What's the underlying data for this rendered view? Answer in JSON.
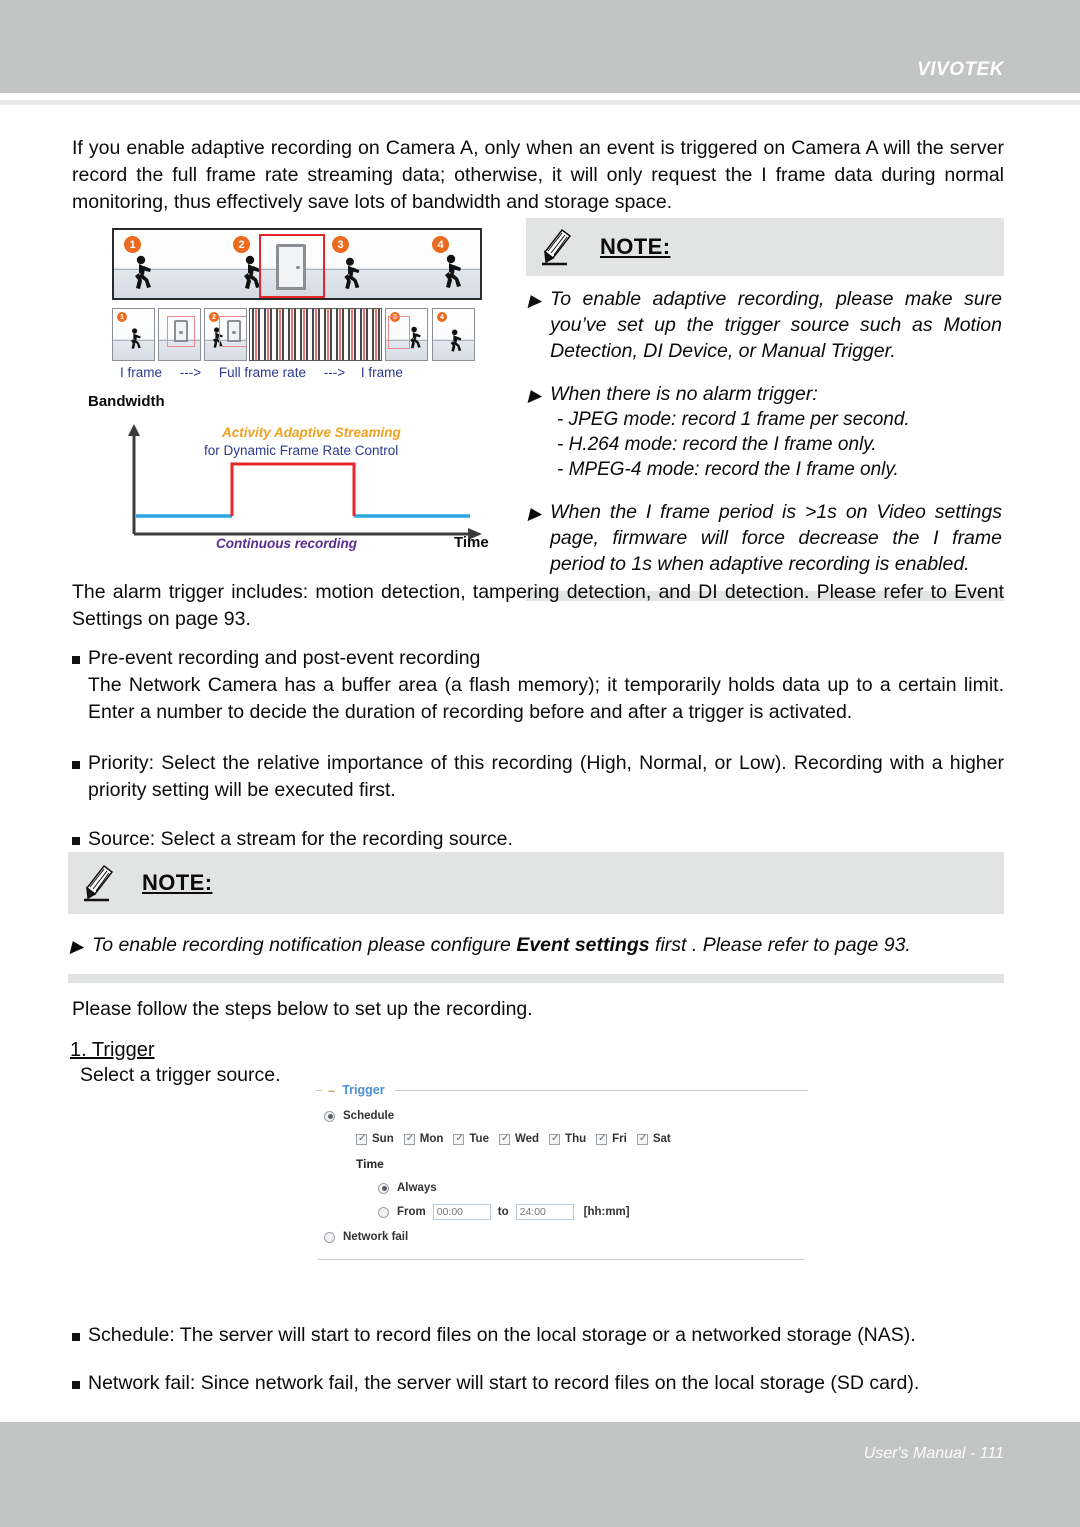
{
  "header": {
    "brand": "VIVOTEK"
  },
  "footer": {
    "text": "User's Manual - 111"
  },
  "intro": {
    "paragraph": "If you enable adaptive recording on Camera A, only when an event is triggered on Camera A will the server record the full frame rate streaming data; otherwise, it will only request the I frame data during normal monitoring, thus effectively save lots of bandwidth and storage space."
  },
  "note1": {
    "icon": "pencil-icon",
    "title": "NOTE:",
    "bullet_glyph": "▶",
    "items": [
      "To enable adaptive recording, please make sure you’ve set up the trigger source such as Motion Detection, DI Device, or Manual Trigger.",
      "When there is no alarm trigger:",
      "When the I frame period is >1s on Video settings page, firmware will force decrease the I frame period to 1s when adaptive recording is enabled."
    ],
    "sub_items": [
      "- JPEG mode: record 1 frame per second.",
      "- H.264 mode: record the I frame only.",
      "- MPEG-4 mode: record the I frame only."
    ]
  },
  "diagram": {
    "scene_badges": [
      "1",
      "2",
      "3",
      "4"
    ],
    "thumb_badges": [
      "1",
      "2",
      "3",
      "4"
    ],
    "frame_labels": {
      "i_frame_left": "I frame",
      "arrow1": "--->",
      "full_frame_rate": "Full frame rate",
      "arrow2": "--->",
      "i_frame_right": "I frame"
    },
    "chart_axis": {
      "y": "Bandwidth",
      "x": "Time"
    },
    "annotations": {
      "adaptive_title": "Activity Adaptive Streaming",
      "adaptive_sub": "for Dynamic Frame Rate Control",
      "continuous": "Continuous recording"
    },
    "colors": {
      "badge": "#ea6b1f",
      "red_line": "#e8262a",
      "blue_line": "#29a7e1",
      "accent_orange": "#f0a020",
      "label_blue": "#2b3a8f",
      "label_purple": "#5a2d8c"
    }
  },
  "chart_data": {
    "type": "line",
    "title": "Activity Adaptive Streaming for Dynamic Frame Rate Control",
    "xlabel": "Time",
    "ylabel": "Bandwidth",
    "grid": false,
    "legend": "none",
    "series": [
      {
        "name": "Continuous recording",
        "color": "#29a7e1",
        "x": [
          0,
          42,
          42,
          84,
          84,
          100
        ],
        "values": [
          12,
          12,
          12,
          12,
          12,
          12
        ]
      },
      {
        "name": "Activity Adaptive Streaming",
        "color": "#e8262a",
        "x": [
          42,
          42,
          84,
          84
        ],
        "values": [
          12,
          78,
          78,
          12
        ]
      }
    ]
  },
  "body": {
    "alarm_paragraph": "The alarm trigger includes: motion detection, tampering detection, and DI detection. Please refer to Event Settings on page 93.",
    "bullets": [
      {
        "head": "Pre-event recording and post-event recording",
        "sub": "The Network Camera has a buffer area (a flash memory); it temporarily holds data up to a certain limit. Enter a number to decide the duration of recording before and after a trigger is activated."
      },
      {
        "head": "Priority: Select the relative importance of this recording (High, Normal, or Low). Recording with a higher priority setting will be executed first.",
        "sub": ""
      },
      {
        "head": "Source: Select a stream for the recording source.",
        "sub": ""
      }
    ]
  },
  "note2": {
    "icon": "pencil-icon",
    "title": "NOTE:",
    "bullet_glyph": "▶",
    "text_before": "To enable recording notification please configure ",
    "text_bold": "Event settings",
    "text_after": " first . Please refer to page 93."
  },
  "steps_intro": "Please follow the steps below to set up the recording.",
  "step1": {
    "heading": "1. Trigger",
    "description": "Select a trigger source."
  },
  "trigger_panel": {
    "collapse_icon": "minus-icon",
    "legend": "Trigger",
    "schedule": {
      "label": "Schedule",
      "selected": true,
      "days": [
        {
          "label": "Sun",
          "checked": true
        },
        {
          "label": "Mon",
          "checked": true
        },
        {
          "label": "Tue",
          "checked": true
        },
        {
          "label": "Wed",
          "checked": true
        },
        {
          "label": "Thu",
          "checked": true
        },
        {
          "label": "Fri",
          "checked": true
        },
        {
          "label": "Sat",
          "checked": true
        }
      ],
      "time_label": "Time",
      "always": {
        "label": "Always",
        "selected": true
      },
      "from": {
        "label": "From",
        "selected": false,
        "from_value": "00:00",
        "to_label": "to",
        "to_value": "24:00",
        "format_hint": "[hh:mm]"
      }
    },
    "network_fail": {
      "label": "Network fail",
      "selected": false
    }
  },
  "tail_bullets": [
    "Schedule: The server will start to record files on the local storage or a networked storage (NAS).",
    "Network fail: Since network fail, the server will start to record files on the local storage (SD card)."
  ]
}
